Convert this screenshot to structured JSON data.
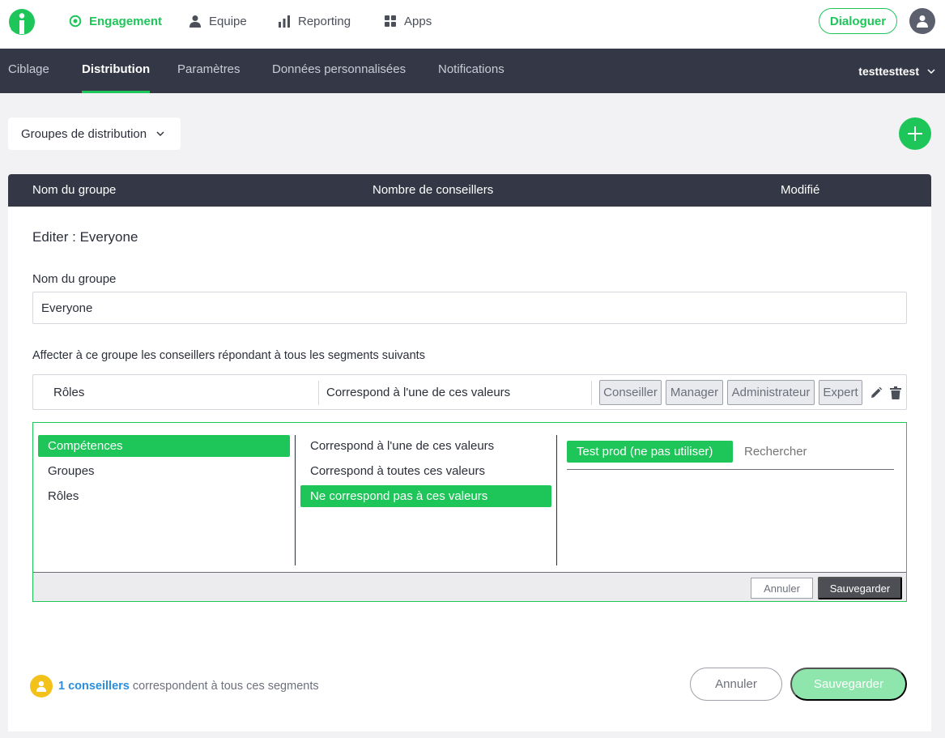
{
  "colors": {
    "accent": "#1ec659",
    "nav_dark": "#343846",
    "link": "#2a8fe0",
    "save_disabled": "#8ee6ad"
  },
  "topnav": {
    "items": [
      {
        "label": "Engagement",
        "icon": "target-icon",
        "active": true
      },
      {
        "label": "Equipe",
        "icon": "person-icon",
        "active": false
      },
      {
        "label": "Reporting",
        "icon": "bar-chart-icon",
        "active": false
      },
      {
        "label": "Apps",
        "icon": "grid-icon",
        "active": false
      }
    ],
    "dialoguer": "Dialoguer"
  },
  "subnav": {
    "tabs": [
      {
        "label": "Ciblage"
      },
      {
        "label": "Distribution"
      },
      {
        "label": "Paramètres"
      },
      {
        "label": "Données personnalisées"
      },
      {
        "label": "Notifications"
      }
    ],
    "active_tab": "Distribution",
    "account": "testtesttest"
  },
  "toolbar": {
    "groups_dropdown": "Groupes de distribution"
  },
  "table": {
    "columns": [
      "Nom du groupe",
      "Nombre de conseillers",
      "Modifié"
    ]
  },
  "editor": {
    "title": "Editer : Everyone",
    "name_label": "Nom du groupe",
    "name_value": "Everyone",
    "segments_label": "Affecter à ce groupe les conseillers répondant à tous les segments suivants",
    "segment": {
      "field": "Rôles",
      "operator": "Correspond à l'une de ces valeurs",
      "values": [
        "Conseiller",
        "Manager",
        "Administrateur",
        "Expert"
      ]
    },
    "builder": {
      "fields": [
        "Compétences",
        "Groupes",
        "Rôles"
      ],
      "selected_field": "Compétences",
      "operators": [
        "Correspond à l'une de ces valeurs",
        "Correspond à toutes ces valeurs",
        "Ne correspond pas à ces valeurs"
      ],
      "selected_operator": "Ne correspond pas à ces valeurs",
      "selected_value": "Test prod (ne pas utiliser)",
      "search_placeholder": "Rechercher",
      "cancel": "Annuler",
      "save": "Sauvegarder"
    }
  },
  "footer": {
    "count_text": "1 conseillers",
    "match_text": "correspondent à tous ces segments",
    "cancel": "Annuler",
    "save": "Sauvegarder"
  }
}
